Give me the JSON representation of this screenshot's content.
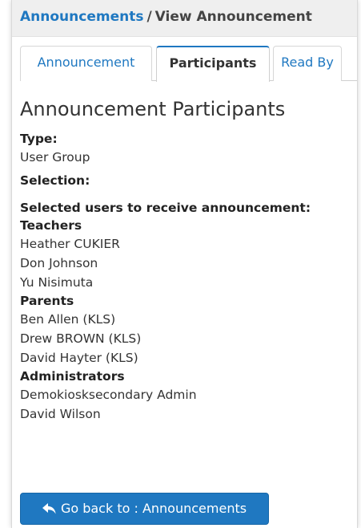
{
  "breadcrumb": {
    "link": "Announcements",
    "separator": "/",
    "current": "View Announcement"
  },
  "tabs": [
    {
      "label": "Announcement",
      "active": false
    },
    {
      "label": "Participants",
      "active": true
    },
    {
      "label": "Read By",
      "active": false
    }
  ],
  "section_title": "Announcement Participants",
  "fields": {
    "type_label": "Type:",
    "type_value": "User Group",
    "selection_label": "Selection:",
    "selected_label": "Selected users to receive announcement:"
  },
  "groups": [
    {
      "name": "Teachers",
      "members": [
        "Heather CUKIER",
        "Don Johnson",
        "Yu Nisimuta"
      ]
    },
    {
      "name": "Parents",
      "members": [
        "Ben Allen (KLS)",
        "Drew BROWN (KLS)",
        "David Hayter (KLS)"
      ]
    },
    {
      "name": "Administrators",
      "members": [
        "Demokiosksecondary Admin",
        "David Wilson"
      ]
    }
  ],
  "back_button": {
    "icon": "reply-arrow-icon",
    "label": "Go back to : Announcements"
  },
  "colors": {
    "accent": "#1f78c1",
    "header_bg": "#efefef"
  }
}
